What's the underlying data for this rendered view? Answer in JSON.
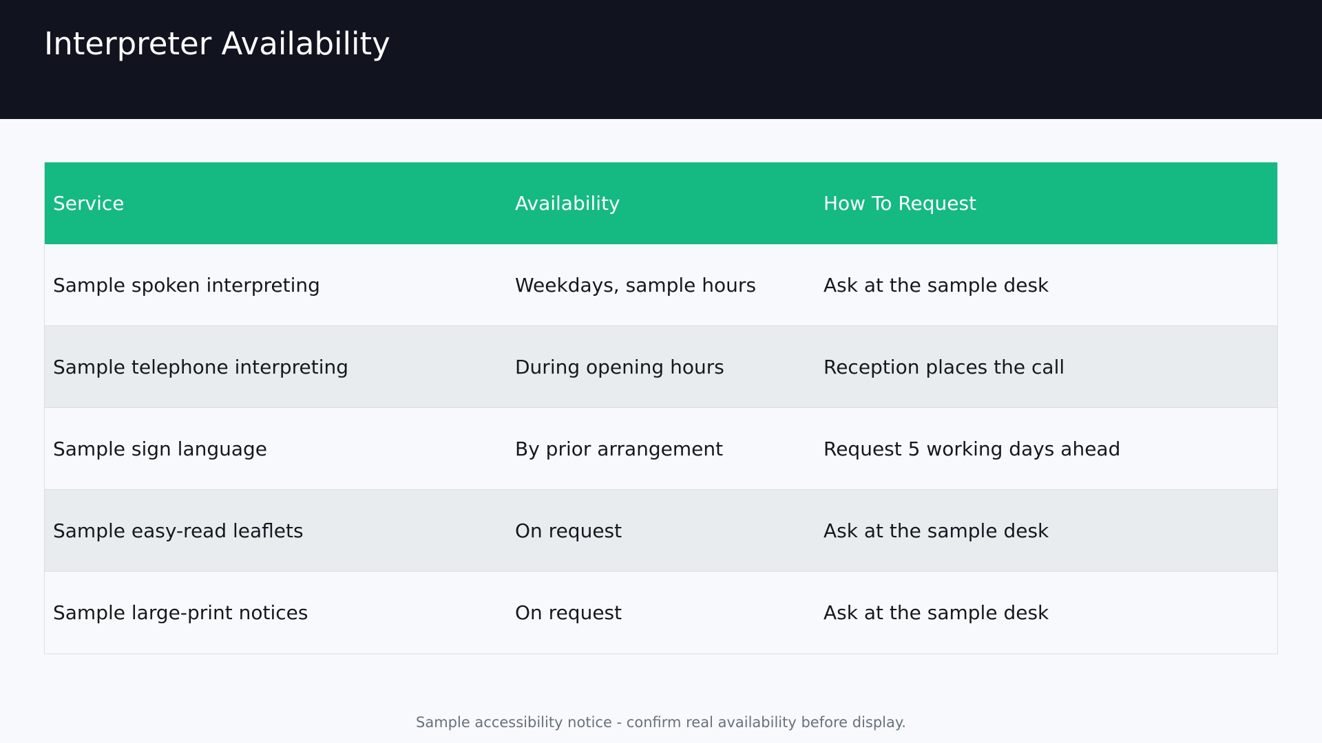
{
  "header": {
    "title": "Interpreter Availability"
  },
  "table": {
    "columns": [
      "Service",
      "Availability",
      "How To Request"
    ],
    "rows": [
      [
        "Sample spoken interpreting",
        "Weekdays, sample hours",
        "Ask at the sample desk"
      ],
      [
        "Sample telephone interpreting",
        "During opening hours",
        "Reception places the call"
      ],
      [
        "Sample sign language",
        "By prior arrangement",
        "Request 5 working days ahead"
      ],
      [
        "Sample easy-read leaflets",
        "On request",
        "Ask at the sample desk"
      ],
      [
        "Sample large-print notices",
        "On request",
        "Ask at the sample desk"
      ]
    ]
  },
  "footer": {
    "notice": "Sample accessibility notice - confirm real availability before display."
  },
  "colors": {
    "header_bg": "#11141e",
    "table_head_bg": "#15b982",
    "row_alt_bg": "#e9ecef",
    "page_bg": "#f7f9fc"
  }
}
